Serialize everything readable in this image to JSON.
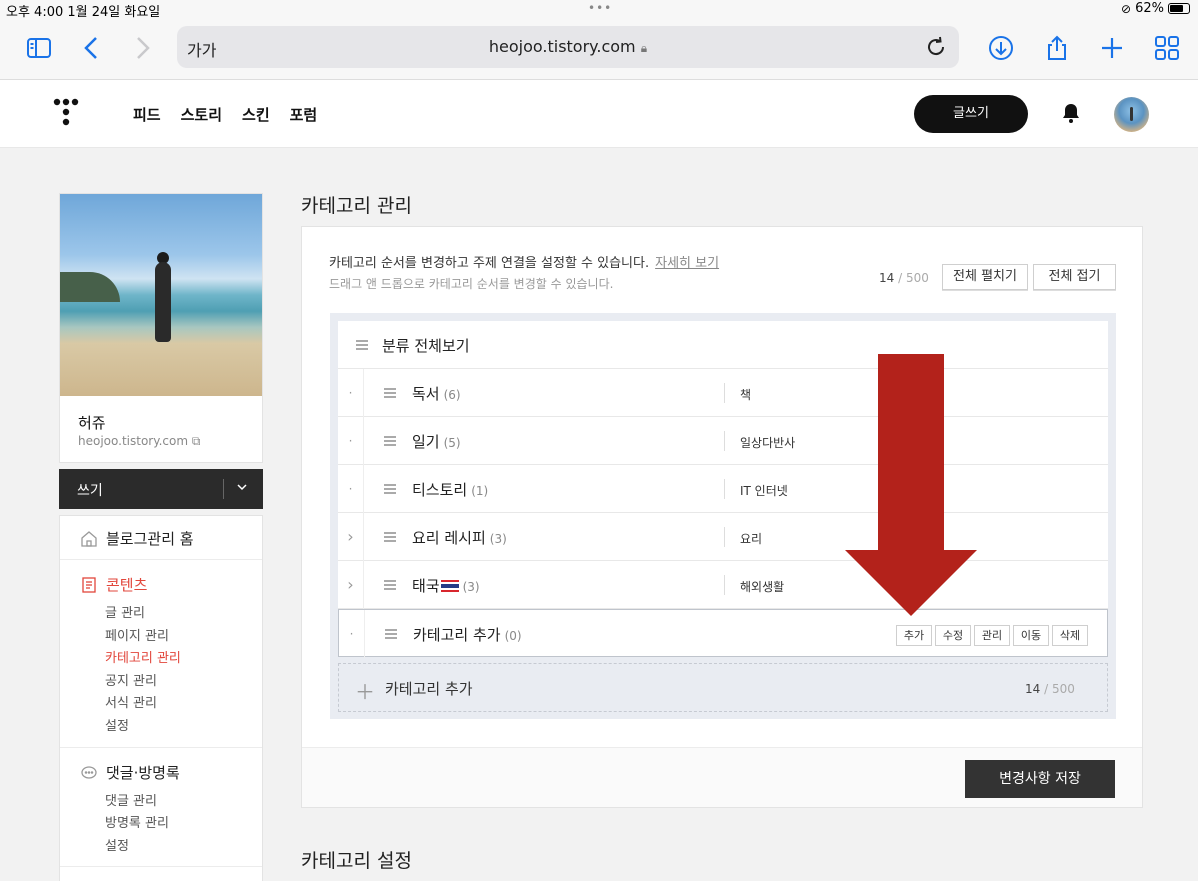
{
  "status": {
    "time_date": "오후 4:00   1월 24일 화요일",
    "dots": "•••",
    "battery": "62%"
  },
  "browser": {
    "aa": "가가",
    "url": "heojoo.tistory.com"
  },
  "header": {
    "nav": [
      "피드",
      "스토리",
      "스킨",
      "포럼"
    ],
    "write": "글쓰기"
  },
  "profile": {
    "name": "허쥬",
    "domain": "heojoo.tistory.com"
  },
  "write_dropdown": "쓰기",
  "menu": {
    "home": "블로그관리 홈",
    "content": "콘텐츠",
    "content_items": [
      "글 관리",
      "페이지 관리",
      "카테고리 관리",
      "공지 관리",
      "서식 관리",
      "설정"
    ],
    "comments": "댓글·방명록",
    "comment_items": [
      "댓글 관리",
      "방명록 관리",
      "설정"
    ]
  },
  "main": {
    "title": "카테고리 관리",
    "desc1": "카테고리 순서를 변경하고 주제 연결을 설정할 수 있습니다.",
    "detail_link": "자세히 보기",
    "desc2": "드래그 앤 드롭으로 카테고리 순서를 변경할 수 있습니다.",
    "count": "14",
    "count_total": "/ 500",
    "expand_all": "전체 펼치기",
    "collapse_all": "전체 접기",
    "root": "분류 전체보기",
    "categories": [
      {
        "toggle": "·",
        "name": "독서",
        "count": "(6)",
        "topic": "책"
      },
      {
        "toggle": "·",
        "name": "일기",
        "count": "(5)",
        "topic": "일상다반사"
      },
      {
        "toggle": "·",
        "name": "티스토리",
        "count": "(1)",
        "topic": "IT 인터넷"
      },
      {
        "toggle": "›",
        "name": "요리 레시피",
        "count": "(3)",
        "topic": "요리"
      },
      {
        "toggle": "›",
        "name": "태국",
        "count": "(3)",
        "topic": "해외생활"
      },
      {
        "toggle": "·",
        "name": "카테고리 추가",
        "count": "(0)",
        "topic": ""
      }
    ],
    "row_buttons": [
      "추가",
      "수정",
      "관리",
      "이동",
      "삭제"
    ],
    "add_category": "카테고리 추가",
    "add_count": "14",
    "add_total": "/ 500",
    "save": "변경사항 저장",
    "settings_title": "카테고리 설정"
  },
  "colors": {
    "accent_red": "#e2463b",
    "arrow_red": "#b3221b",
    "browser_blue": "#1a73e8"
  }
}
